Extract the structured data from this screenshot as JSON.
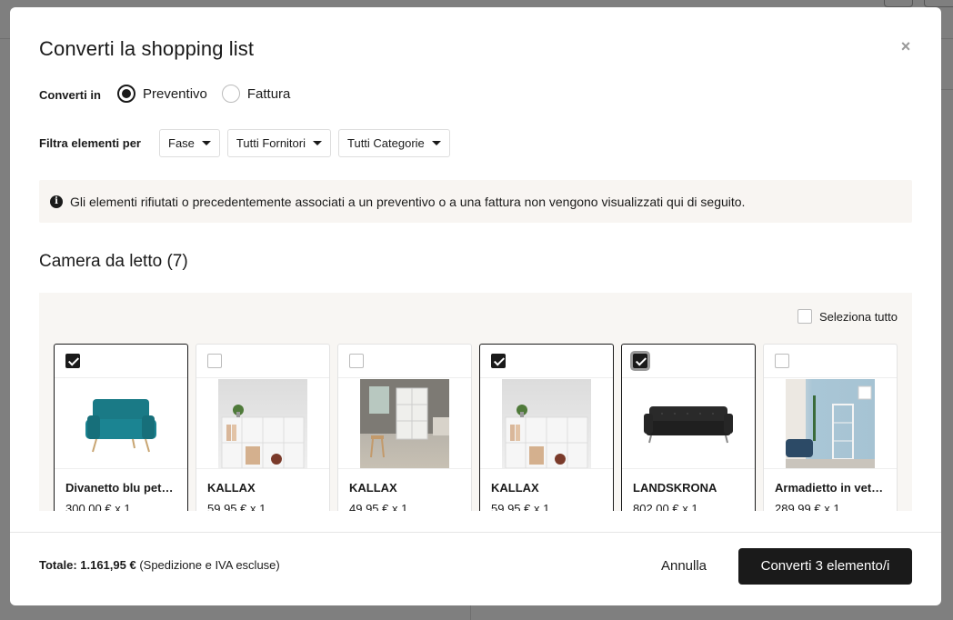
{
  "modal": {
    "title": "Converti la shopping list",
    "close_label": "×"
  },
  "convert": {
    "label": "Converti in",
    "options": [
      {
        "label": "Preventivo",
        "checked": true
      },
      {
        "label": "Fattura",
        "checked": false
      }
    ]
  },
  "filter": {
    "label": "Filtra elementi per",
    "buttons": [
      "Fase",
      "Tutti Fornitori",
      "Tutti Categorie"
    ]
  },
  "info": {
    "icon": "info-icon",
    "text": "Gli elementi rifiutati o precedentemente associati a un preventivo o a una fattura non vengono visualizzati qui di seguito."
  },
  "section": {
    "title": "Camera da letto (7)",
    "select_all_label": "Seleziona tutto"
  },
  "products": [
    {
      "name": "Divanetto blu pet…",
      "price": "300,00 € x 1",
      "checked": true,
      "image": "blue-sofa-bed"
    },
    {
      "name": "KALLAX",
      "price": "59,95 € x 1",
      "checked": false,
      "image": "white-shelf-unit"
    },
    {
      "name": "KALLAX",
      "price": "49,95 € x 1",
      "checked": false,
      "image": "shelf-in-room"
    },
    {
      "name": "KALLAX",
      "price": "59,95 € x 1",
      "checked": true,
      "image": "white-shelf-unit"
    },
    {
      "name": "LANDSKRONA",
      "price": "802,00 € x 1",
      "checked": true,
      "image": "black-leather-sofa"
    },
    {
      "name": "Armadietto in vet…",
      "price": "289,99 € x 1",
      "checked": false,
      "image": "glass-cabinet-room"
    }
  ],
  "footer": {
    "total_label": "Totale: 1.161,95 €",
    "total_note": "(Spedizione e IVA escluse)",
    "cancel_label": "Annulla",
    "convert_label": "Converti 3 elemento/i"
  },
  "colors": {
    "primary": "#1a1a1a",
    "info_bg": "#f8f5f2",
    "grid_bg": "#f8f6f3"
  }
}
